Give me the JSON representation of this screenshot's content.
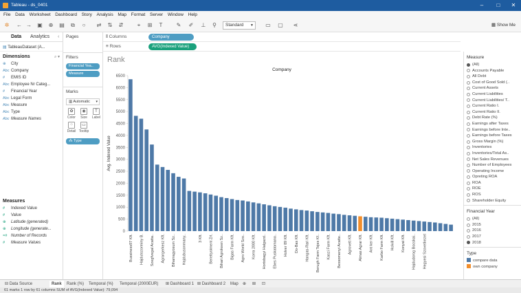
{
  "window": {
    "title": "Tableau - ds_0401"
  },
  "menu": [
    "File",
    "Data",
    "Worksheet",
    "Dashboard",
    "Story",
    "Analysis",
    "Map",
    "Format",
    "Server",
    "Window",
    "Help"
  ],
  "toolbar": {
    "fit_mode": "Standard",
    "show_me": "Show Me"
  },
  "datapane": {
    "tabs": [
      "Data",
      "Analytics"
    ],
    "datasource": "TableauDataset (A...",
    "dimensions_title": "Dimensions",
    "dimensions": [
      {
        "type": "globe-icon",
        "label": "City"
      },
      {
        "type": "Abc",
        "label": "Company"
      },
      {
        "type": "#",
        "label": "EMIS ID"
      },
      {
        "type": "Abc",
        "label": "Employee Nr Categ..."
      },
      {
        "type": "#",
        "label": "Financial Year"
      },
      {
        "type": "Abc",
        "label": "Legal Form"
      },
      {
        "type": "Abc",
        "label": "Measure"
      },
      {
        "type": "Abc",
        "label": "Type"
      },
      {
        "type": "Abc",
        "label": "Measure Names"
      }
    ],
    "measures_title": "Measures",
    "measures": [
      {
        "type": "#",
        "label": "Indexed Value"
      },
      {
        "type": "#",
        "label": "Value"
      },
      {
        "type": "globe-icon",
        "label": "Latitude (generated)"
      },
      {
        "type": "globe-icon",
        "label": "Longitude (generate..."
      },
      {
        "type": "=#",
        "label": "Number of Records"
      },
      {
        "type": "#",
        "label": "Measure Values"
      }
    ]
  },
  "cards": {
    "pages": "Pages",
    "filters": "Filters",
    "filter_pills": [
      "Financial Yea..",
      "Measure"
    ],
    "marks": "Marks",
    "marks_type": "Automatic",
    "marks_buttons": [
      "Color",
      "Size",
      "Label",
      "Detail",
      "Tooltip"
    ],
    "marks_pill": "Type"
  },
  "shelves": {
    "columns_label": "Columns",
    "columns_pill": "Company",
    "rows_label": "Rows",
    "rows_pill": "AVG(Indexed Value)"
  },
  "viz": {
    "title": "Rank",
    "header": "Company"
  },
  "chart_data": {
    "type": "bar",
    "title": "Rank",
    "xlabel": "Company",
    "ylabel": "Avg. Indexed Value",
    "ylim": [
      0,
      6500
    ],
    "yticks": [
      0,
      500,
      1000,
      1500,
      2000,
      2500,
      3000,
      3500,
      4000,
      4500,
      5000,
      5500,
      6000,
      6500
    ],
    "grid": false,
    "categories": [
      "Bussiness97 Kft.",
      "",
      "Hajdutozorminy B.",
      "",
      "Szegfvegal Acatta..",
      "",
      "Agrargerkesz Kft.",
      "",
      "Biharragyosum Sz..",
      "",
      "Hajdubusonmany..",
      "",
      "",
      "3 Kft.",
      "",
      "Berettyoiment Zrt.",
      "",
      "Bihari Agrokeen Sz..",
      "",
      "Bigas Farm Kft.",
      "",
      "Agro World Szo..",
      "",
      "Korra 2000 Kft.",
      "",
      "Hortobagyi Halgazd..",
      "",
      "Ebes Puskatomano..",
      "",
      "Holver 89 Kft.",
      "",
      "Do-Bas Kft.",
      "",
      "Hangas-Rari Kft.",
      "",
      "Berugh Farm Tejes Kf..",
      "",
      "Kaszi Farm Kft.",
      "",
      "Bessomenyi Acatte..",
      "",
      "Agrovett Kft.",
      "",
      "Almas Agrar Kft.",
      "",
      "Ant ker Kft.",
      "",
      "Karbo Farm Kft.",
      "",
      "Holvill Kft.",
      "",
      "Konyat Kft.",
      "",
      "Hajdudorog Bocskai..",
      "",
      "Hegyesi Szovetkezet"
    ],
    "series": [
      {
        "values": [
          6350,
          4820,
          4700,
          4250,
          3620,
          2780,
          2680,
          2560,
          2420,
          2270,
          2200,
          1680,
          1650,
          1620,
          1580,
          1530,
          1480,
          1420,
          1380,
          1340,
          1300,
          1280,
          1240,
          1200,
          1160,
          1120,
          1080,
          1040,
          1010,
          980,
          940,
          910,
          880,
          860,
          830,
          800,
          780,
          760,
          730,
          710,
          680,
          660,
          640,
          620,
          600,
          580,
          570,
          560,
          540,
          520,
          500,
          480,
          460,
          440,
          420,
          400,
          380,
          360,
          330,
          300,
          270
        ],
        "highlight_index": 43
      }
    ],
    "colors": {
      "compare": "#4e79a7",
      "own": "#f28e2b"
    }
  },
  "legend": {
    "measure_title": "Measure",
    "measure_items": [
      "(All)",
      "Accounts Payable",
      "All Debt",
      "Cost of Good Sold (..",
      "Current Assets",
      "Current Liabilities",
      "Current Liabilities/ T..",
      "Current Ratio I.",
      "Current Ratio II.",
      "Debt Rate (%)",
      "Earnings after Taxes",
      "Earnings before Inte..",
      "Earnings before Taxes",
      "Gross Margin (%)",
      "Inventories",
      "Inventories/Total As..",
      "Net Sales Revenues",
      "Number of Employees",
      "Operating Income",
      "Opreting ROA",
      "ROA",
      "ROE",
      "ROS",
      "Shareholder Equity"
    ],
    "measure_selected": 0,
    "year_title": "Financial Year",
    "year_items": [
      "(All)",
      "2015",
      "2016",
      "2017",
      "2018"
    ],
    "year_selected": 4,
    "type_title": "Type",
    "type_items": [
      {
        "label": "compare data",
        "color": "#4e79a7"
      },
      {
        "label": "own company",
        "color": "#f28e2b"
      }
    ]
  },
  "sheets": [
    "Data Source",
    "Rank",
    "Rank (%)",
    "Temporal (%)",
    "Temporal (2000EUR)",
    "Dashboard 1",
    "Dashboard 2",
    "Map"
  ],
  "active_sheet": 1,
  "status": "61 marks   1 row by 61 columns   SUM of AVG(Indexed Value): 79,094"
}
